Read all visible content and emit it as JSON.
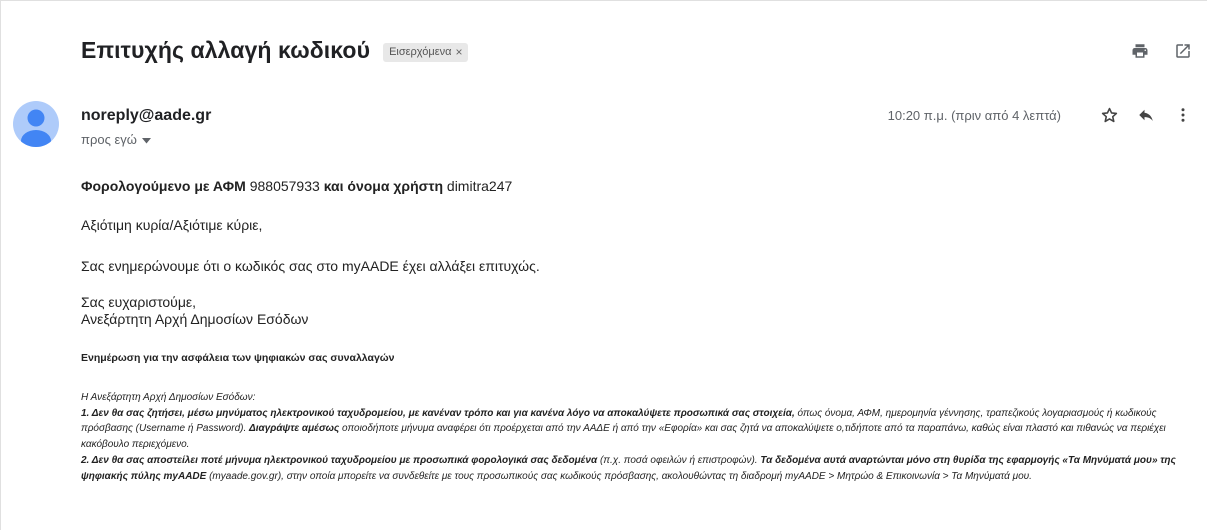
{
  "email": {
    "subject": "Επιτυχής αλλαγή κωδικού",
    "label": "Εισερχόμενα",
    "label_remove": "×",
    "sender": "noreply@aade.gr",
    "to": "προς εγώ",
    "time": "10:20 π.μ. (πριν από 4 λεπτά)"
  },
  "icons": {
    "print": "print-icon",
    "open_new": "open-in-new-window-icon",
    "star": "star-icon",
    "reply": "reply-icon",
    "more": "more-vert-icon",
    "dropdown": "caret-down-icon",
    "avatar": "person-avatar-icon"
  },
  "colors": {
    "avatar_bg": "#aecbfa",
    "avatar_fg": "#4285f4",
    "label_bg": "#e8e8e8"
  },
  "message": {
    "line1_a": "Φορολογούμενο με ΑΦΜ",
    "line1_b": " 988057933 ",
    "line1_c": "και όνομα χρήστη",
    "line1_d": " dimitra247",
    "greeting": "Αξιότιμη κυρία/Αξιότιμε κύριε,",
    "inform": "Σας ενημερώνουμε ότι ο κωδικός σας στο myAADE έχει αλλάξει επιτυχώς.",
    "thanks": "Σας ευχαριστούμε,",
    "signature": "Ανεξάρτητη Αρχή Δημοσίων Εσόδων",
    "security_title": "Ενημέρωση για την ασφάλεια των ψηφιακών σας συναλλαγών",
    "notice": {
      "intro": "Η Ανεξάρτητη Αρχή Δημοσίων Εσόδων:",
      "n1_bold": "1. Δεν θα σας ζητήσει, μέσω μηνύματος ηλεκτρονικού ταχυδρομείου, με κανέναν τρόπο και για κανένα λόγο να αποκαλύψετε προσωπικά σας στοιχεία,",
      "n1_rest": " όπως όνομα, ΑΦΜ, ημερομηνία γέννησης, τραπεζικούς λογαριασμούς ή κωδικούς πρόσβασης (Username ή Password). ",
      "n1_bold2": "Διαγράψτε αμέσως",
      "n1_rest2": " οποιοδήποτε μήνυμα αναφέρει ότι προέρχεται από την ΑΑΔΕ ή από την «Εφορία» και σας ζητά να αποκαλύψετε ο,τιδήποτε από τα παραπάνω, καθώς είναι πλαστό και πιθανώς να περιέχει κακόβουλο περιεχόμενο.",
      "n2_bold": "2. Δεν θα σας αποστείλει ποτέ μήνυμα ηλεκτρονικού ταχυδρομείου με προσωπικά φορολογικά σας δεδομένα",
      "n2_rest": " (π.χ. ποσά οφειλών ή επιστροφών). ",
      "n2_bold2": "Τα δεδομένα αυτά αναρτώνται μόνο στη θυρίδα της εφαρμογής «Τα Μηνύματά μου» της ψηφιακής πύλης myAADE",
      "n2_rest2": " (myaade.gov.gr), στην οποία μπορείτε να συνδεθείτε με τους προσωπικούς σας κωδικούς πρόσβασης, ακολουθώντας τη διαδρομή myAADE > Μητρώο & Επικοινωνία > Τα Μηνύματά μου."
    }
  }
}
